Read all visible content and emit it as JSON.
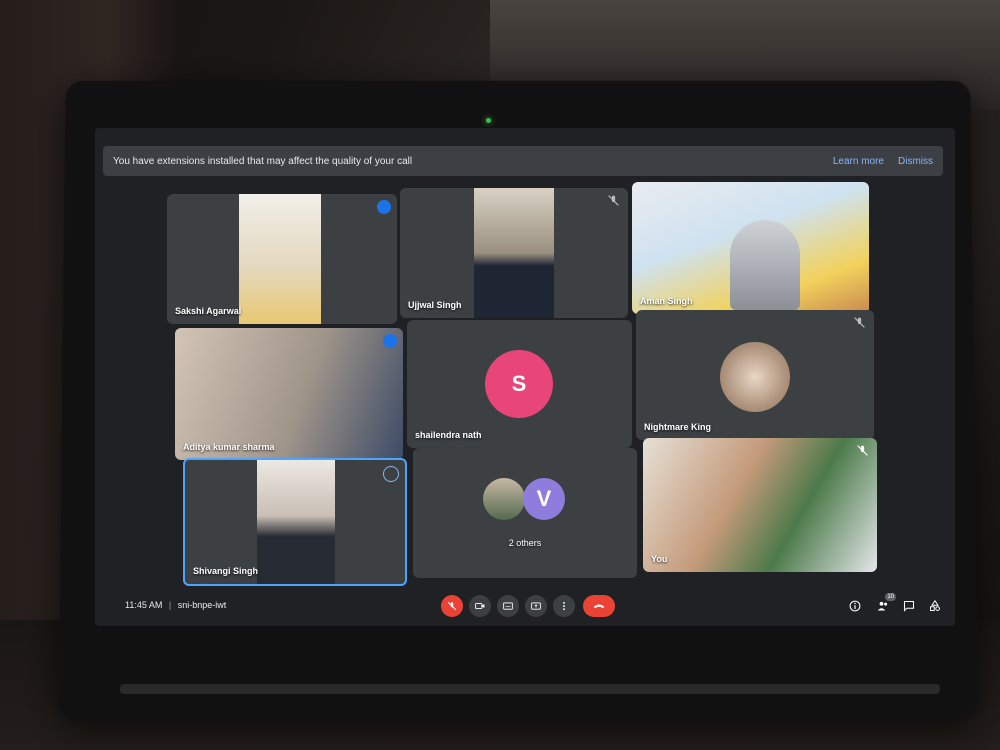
{
  "banner": {
    "message": "You have extensions installed that may affect the quality of your call",
    "learn_more": "Learn more",
    "dismiss": "Dismiss"
  },
  "participants": [
    {
      "name": "Sakshi Agarwal",
      "status": "speaking"
    },
    {
      "name": "Ujjwal Singh",
      "status": "muted"
    },
    {
      "name": "Aman Singh",
      "status": "video"
    },
    {
      "name": "Aditya kumar sharma",
      "status": "speaking"
    },
    {
      "name": "shailendra nath",
      "initial": "S",
      "avatar_color": "#e8457a"
    },
    {
      "name": "Nightmare King",
      "status": "muted"
    },
    {
      "name": "Shivangi Singh",
      "status": "pinned-menu"
    },
    {
      "name": "2 others",
      "initial": "V",
      "avatar_color": "#8e7ddc"
    },
    {
      "name": "You",
      "status": "muted"
    }
  ],
  "footer": {
    "time": "11:45 AM",
    "separator": "|",
    "meeting_code": "sni-bnpe-iwt",
    "participant_count": "10"
  },
  "colors": {
    "accent": "#1a73e8",
    "danger": "#ea4335",
    "tile": "#3c4043"
  }
}
